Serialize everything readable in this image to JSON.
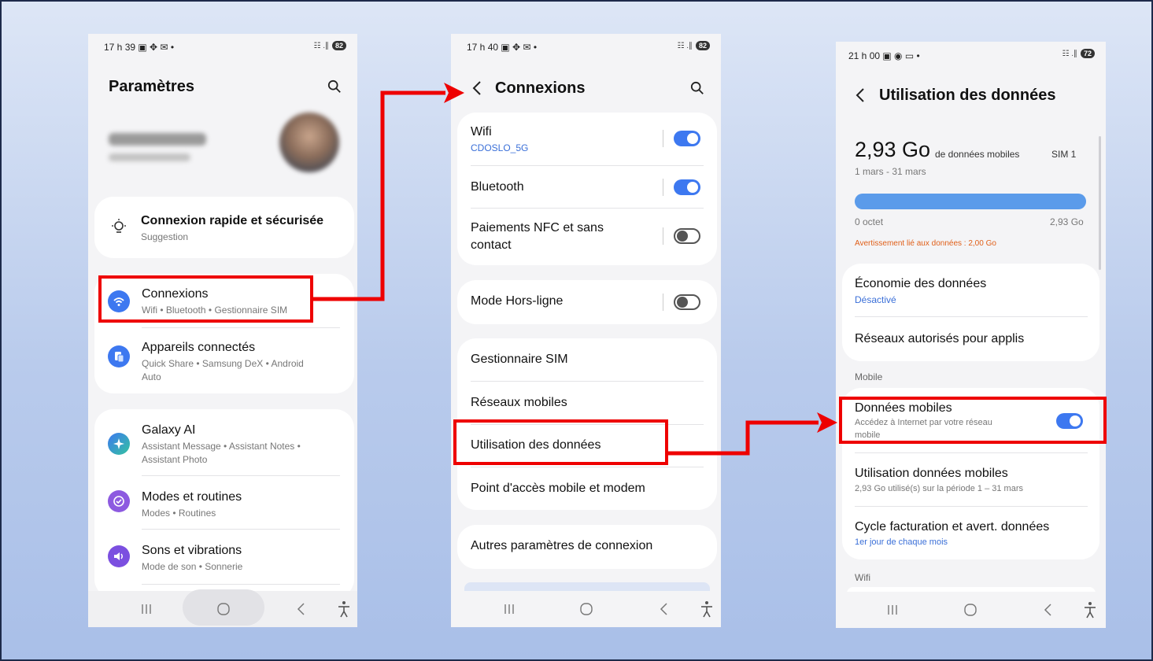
{
  "phone1": {
    "status_time": "17 h 39 ▣ ✥ ✉ •",
    "status_right": "☷ .∥",
    "battery": "82",
    "title": "Paramètres",
    "quick": {
      "title": "Connexion rapide et sécurisée",
      "sub": "Suggestion"
    },
    "items": [
      {
        "title": "Connexions",
        "sub": "Wifi • Bluetooth • Gestionnaire SIM"
      },
      {
        "title": "Appareils connectés",
        "sub": "Quick Share • Samsung DeX • Android",
        "sub2": "Auto"
      },
      {
        "title": "Galaxy AI",
        "sub": "Assistant Message • Assistant Notes •",
        "sub2": "Assistant Photo"
      },
      {
        "title": "Modes et routines",
        "sub": "Modes • Routines"
      },
      {
        "title": "Sons et vibrations",
        "sub": "Mode de son • Sonnerie"
      }
    ]
  },
  "phone2": {
    "status_time": "17 h 40 ▣ ✥ ✉ •",
    "status_right": "☷ .∥",
    "battery": "82",
    "title": "Connexions",
    "wifi": {
      "title": "Wifi",
      "sub": "CDOSLO_5G"
    },
    "bluetooth": "Bluetooth",
    "nfc": {
      "line1": "Paiements NFC et sans",
      "line2": "contact"
    },
    "airplane": "Mode Hors-ligne",
    "sim": "Gestionnaire SIM",
    "mobile_networks": "Réseaux mobiles",
    "data_usage": "Utilisation des données",
    "hotspot": "Point d'accès mobile et modem",
    "other": "Autres paramètres de connexion"
  },
  "phone3": {
    "status_time": "21 h 00 ▣ ◉ ▭ •",
    "status_right": "☷ .∥",
    "battery": "72",
    "title": "Utilisation des données",
    "amount": "2,93 Go",
    "amount_suffix": "de données mobiles",
    "sim": "SIM 1",
    "period": "1 mars - 31 mars",
    "bar_min": "0 octet",
    "bar_max": "2,93 Go",
    "bar_fraction": 1.0,
    "warning": "Avertissement lié aux données : 2,00 Go",
    "saver": {
      "title": "Économie des données",
      "sub": "Désactivé"
    },
    "allowed": "Réseaux autorisés pour applis",
    "section_mobile": "Mobile",
    "mobile_data": {
      "title": "Données mobiles",
      "sub": "Accédez à Internet par votre réseau",
      "sub2": "mobile"
    },
    "mobile_usage": {
      "title": "Utilisation données mobiles",
      "sub": "2,93 Go utilisé(s) sur la période 1 – 31 mars"
    },
    "billing": {
      "title": "Cycle facturation et avert. données",
      "sub": "1er jour de chaque mois"
    },
    "section_wifi": "Wifi"
  },
  "colors": {
    "accent": "#3d78f0",
    "highlight": "#ee0000",
    "warning": "#e0601a"
  }
}
